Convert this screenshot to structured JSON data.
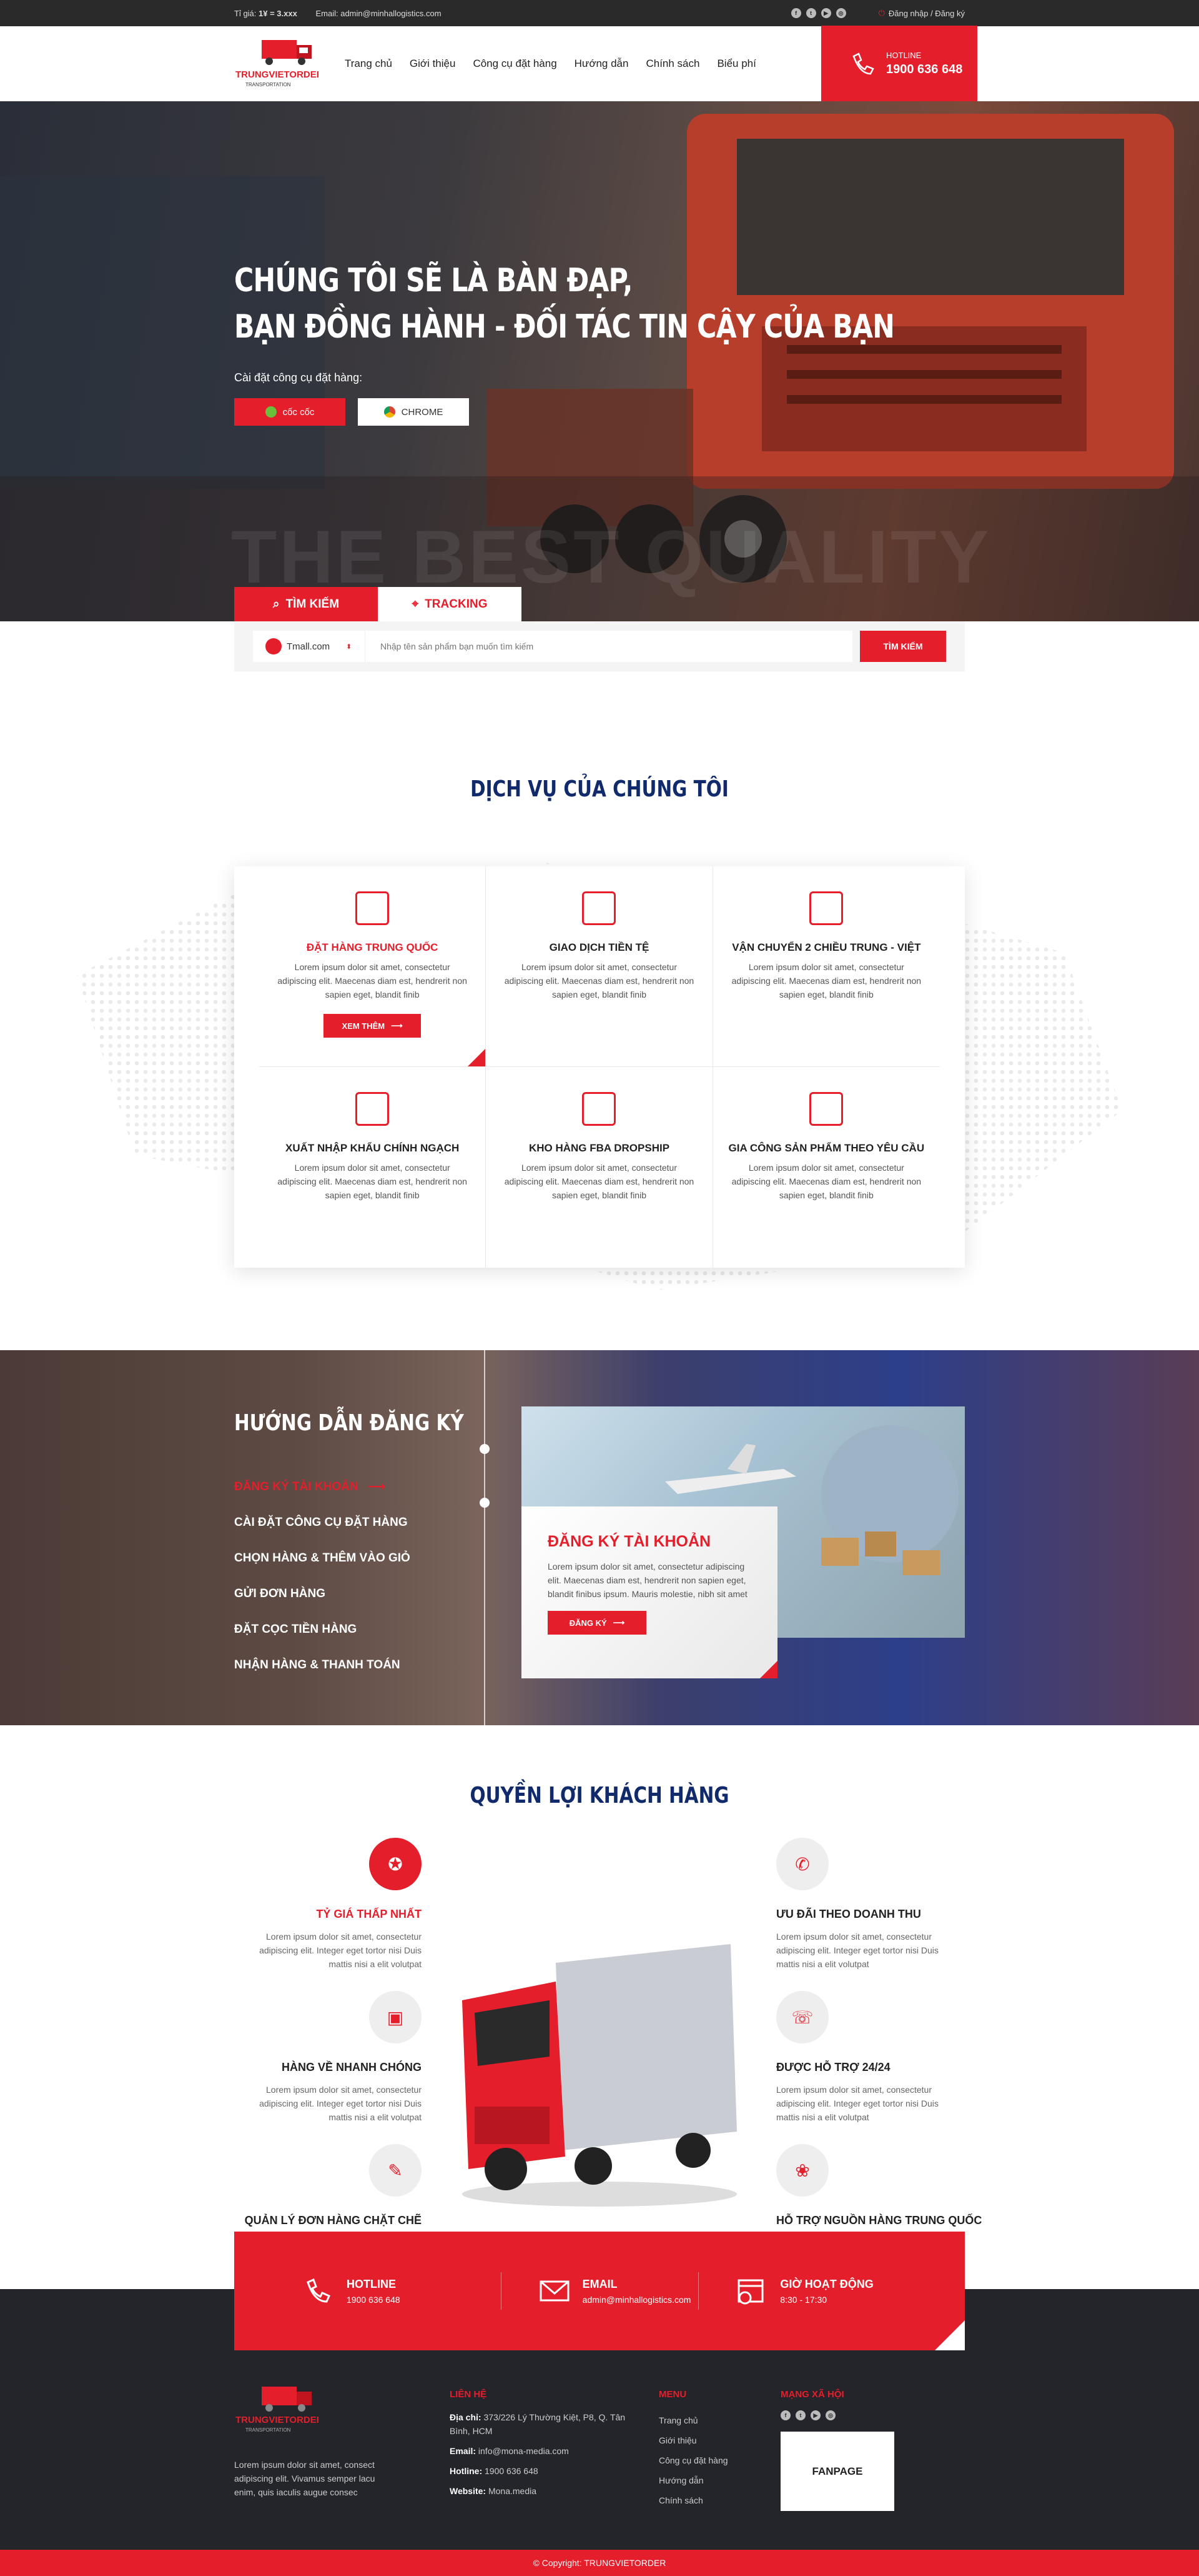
{
  "topbar": {
    "rate_label": "Tỉ giá:",
    "rate_value": "1¥ = 3.xxx",
    "email_label": "Email:",
    "email_value": "admin@minhallogistics.com",
    "login": "Đăng nhập / Đăng ký"
  },
  "header": {
    "logo_text": "TRUNGVIETORDER",
    "logo_sub": "TRANSPORTATION",
    "nav": [
      "Trang chủ",
      "Giới thiệu",
      "Công cụ đặt hàng",
      "Hướng dẫn",
      "Chính sách",
      "Biểu phí"
    ],
    "hotline_label": "HOTLINE",
    "hotline_number": "1900 636 648"
  },
  "hero": {
    "title_line1": "CHÚNG TÔI SẼ LÀ BÀN ĐẠP,",
    "title_line2": "BẠN ĐỒNG HÀNH - ĐỐI TÁC TIN CẬY CỦA BẠN",
    "subtitle": "Cài đặt công cụ đặt hàng:",
    "btn1": "cốc cốc",
    "btn2": "CHROME",
    "watermark": "THE BEST QUALITY"
  },
  "search": {
    "tab1": "TÌM KIẾM",
    "tab2": "TRACKING",
    "site": "Tmall.com",
    "placeholder": "Nhập tên sản phẩm bạn muốn tìm kiếm",
    "button": "TÌM KIẾM"
  },
  "services": {
    "title": "DỊCH VỤ CỦA CHÚNG TÔI",
    "more_label": "XEM THÊM",
    "items": [
      {
        "title": "ĐẶT HÀNG TRUNG QUỐC",
        "desc": "Lorem ipsum dolor sit amet, consectetur adipiscing elit. Maecenas diam est, hendrerit non sapien eget, blandit finib"
      },
      {
        "title": "GIAO DỊCH TIỀN TỆ",
        "desc": "Lorem ipsum dolor sit amet, consectetur adipiscing elit. Maecenas diam est, hendrerit non sapien eget, blandit finib"
      },
      {
        "title": "VẬN CHUYỂN 2 CHIỀU TRUNG - VIỆT",
        "desc": "Lorem ipsum dolor sit amet, consectetur adipiscing elit. Maecenas diam est, hendrerit non sapien eget, blandit finib"
      },
      {
        "title": "XUẤT NHẬP KHẨU CHÍNH NGẠCH",
        "desc": "Lorem ipsum dolor sit amet, consectetur adipiscing elit. Maecenas diam est, hendrerit non sapien eget, blandit finib"
      },
      {
        "title": "KHO HÀNG FBA DROPSHIP",
        "desc": "Lorem ipsum dolor sit amet, consectetur adipiscing elit. Maecenas diam est, hendrerit non sapien eget, blandit finib"
      },
      {
        "title": "GIA CÔNG SẢN PHẨM THEO YÊU CẦU",
        "desc": "Lorem ipsum dolor sit amet, consectetur adipiscing elit. Maecenas diam est, hendrerit non sapien eget, blandit finib"
      }
    ]
  },
  "guide": {
    "title": "HƯỚNG DẪN ĐĂNG KÝ",
    "steps": [
      "ĐĂNG KÝ TÀI KHOẢN",
      "CÀI ĐẶT CÔNG CỤ ĐẶT HÀNG",
      "CHỌN HÀNG & THÊM VÀO GIỎ",
      "GỬI ĐƠN HÀNG",
      "ĐẶT CỌC TIỀN HÀNG",
      "NHẬN HÀNG & THANH TOÁN"
    ],
    "card_title": "ĐĂNG KÝ TÀI KHOẢN",
    "card_desc": "Lorem ipsum dolor sit amet, consectetur adipiscing elit. Maecenas diam est, hendrerit non sapien eget, blandit finibus ipsum. Mauris molestie, nibh sit amet",
    "card_btn": "ĐĂNG KÝ"
  },
  "benefits": {
    "title": "QUYỀN LỢI KHÁCH HÀNG",
    "desc": "Lorem ipsum dolor sit amet, consectetur adipiscing elit. Integer eget tortor nisi Duis mattis nisi a elit volutpat",
    "items": [
      {
        "title": "TỶ GIÁ THẤP NHẤT"
      },
      {
        "title": "HÀNG VỀ NHANH CHÓNG"
      },
      {
        "title": "QUẢN LÝ ĐƠN HÀNG CHẶT CHẼ"
      },
      {
        "title": "ƯU ĐÃI THEO DOANH THU"
      },
      {
        "title": "ĐƯỢC HỖ TRỢ 24/24"
      },
      {
        "title": "HỖ TRỢ NGUỒN HÀNG TRUNG QUỐC"
      }
    ]
  },
  "contact": {
    "hotline_label": "HOTLINE",
    "hotline_value": "1900 636 648",
    "email_label": "EMAIL",
    "email_value": "admin@minhallogistics.com",
    "hours_label": "GIỜ HOẠT ĐỘNG",
    "hours_value": "8:30 - 17:30"
  },
  "footer": {
    "about": "Lorem ipsum dolor sit amet, consect adipiscing elit. Vivamus semper lacu enim, quis iaculis augue consec",
    "contact_title": "LIÊN HỆ",
    "address_label": "Địa chỉ:",
    "address": "373/226 Lý Thường Kiệt, P8, Q. Tân Bình, HCM",
    "email_label": "Email:",
    "email": "info@mona-media.com",
    "hotline_label": "Hotline:",
    "hotline": "1900 636 648",
    "website_label": "Website:",
    "website": "Mona.media",
    "menu_title": "MENU",
    "menu": [
      "Trang chủ",
      "Giới thiệu",
      "Công cụ đặt hàng",
      "Hướng dẫn",
      "Chính sách"
    ],
    "social_title": "MẠNG XÃ HỘI",
    "fanpage": "FANPAGE",
    "copyright": "© Copyright: TRUNGVIETORDER"
  },
  "colors": {
    "brand": "#e41e2b",
    "navy": "#102a6b",
    "dark": "#23252b"
  }
}
